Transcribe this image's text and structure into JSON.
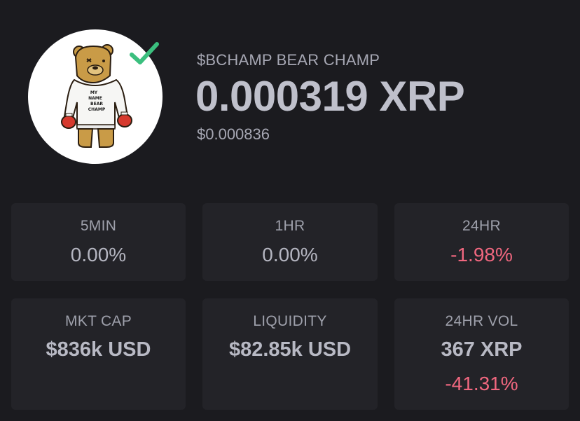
{
  "token": {
    "name": "$BCHAMP BEAR CHAMP",
    "price_xrp": "0.000319 XRP",
    "price_usd": "$0.000836",
    "verified": true,
    "avatar_icon": "bear-champ-logo",
    "shirt_text": [
      "MY",
      "NAME",
      "BEAR",
      "CHAMP"
    ]
  },
  "changes": [
    {
      "label": "5MIN",
      "value": "0.00%"
    },
    {
      "label": "1HR",
      "value": "0.00%"
    },
    {
      "label": "24HR",
      "value": "-1.98%"
    }
  ],
  "stats": {
    "mkt_cap": {
      "label": "MKT CAP",
      "value": "$836k USD"
    },
    "liquidity": {
      "label": "LIQUIDITY",
      "value": "$82.85k USD"
    },
    "vol": {
      "label": "24HR VOL",
      "value": "367 XRP",
      "change": "-41.31%"
    }
  },
  "colors": {
    "background": "#1b1b1f",
    "card": "#232328",
    "negative": "#f0677f",
    "verified": "#3bbf7e"
  }
}
